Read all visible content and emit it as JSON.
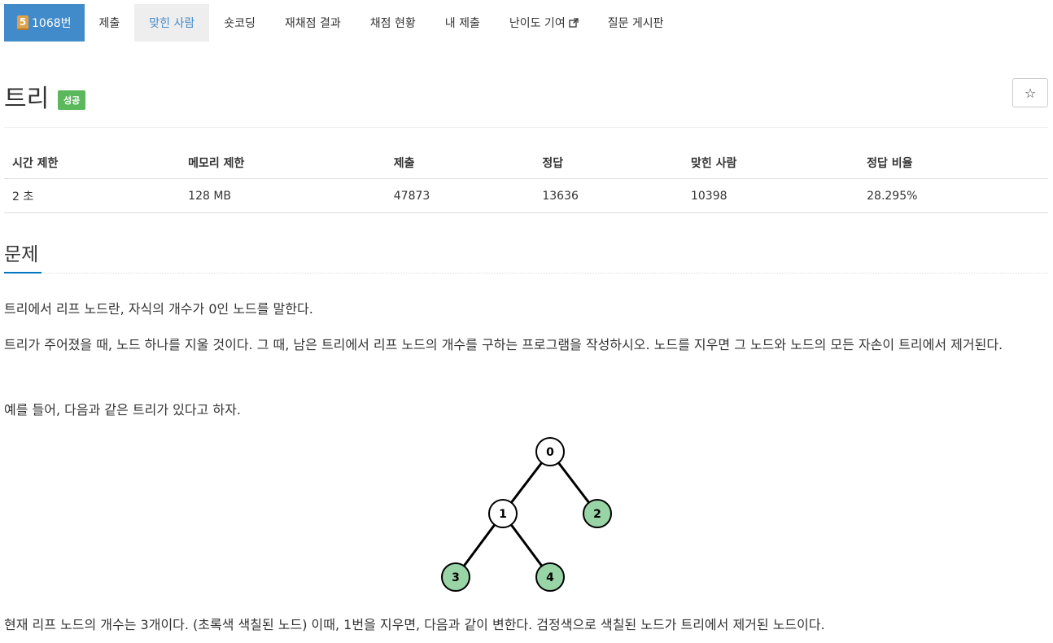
{
  "nav": {
    "problem_badge": "5",
    "problem_number": "1068번",
    "tabs": [
      "제출",
      "맞힌 사람",
      "숏코딩",
      "재채점 결과",
      "채점 현황",
      "내 제출",
      "난이도 기여",
      "질문 게시판"
    ]
  },
  "header": {
    "title": "트리",
    "status": "성공",
    "star": "☆"
  },
  "info_table": {
    "headers": [
      "시간 제한",
      "메모리 제한",
      "제출",
      "정답",
      "맞힌 사람",
      "정답 비율"
    ],
    "values": [
      "2 초",
      "128 MB",
      "47873",
      "13636",
      "10398",
      "28.295%"
    ]
  },
  "section": {
    "title": "문제",
    "paragraphs": [
      "트리에서 리프 노드란, 자식의 개수가 0인 노드를 말한다.",
      "트리가 주어졌을 때, 노드 하나를 지울 것이다. 그 때, 남은 트리에서 리프 노드의 개수를 구하는 프로그램을 작성하시오. 노드를 지우면 그 노드와 노드의 모든 자손이 트리에서 제거된다.",
      "예를 들어, 다음과 같은 트리가 있다고 하자.",
      "현재 리프 노드의 개수는 3개이다. (초록색 색칠된 노드) 이때, 1번을 지우면, 다음과 같이 변한다. 검정색으로 색칠된 노드가 트리에서 제거된 노드이다."
    ]
  },
  "tree_figure": {
    "nodes": [
      {
        "label": "0",
        "leaf": false
      },
      {
        "label": "1",
        "leaf": false
      },
      {
        "label": "2",
        "leaf": true
      },
      {
        "label": "3",
        "leaf": true
      },
      {
        "label": "4",
        "leaf": true
      }
    ],
    "edges": [
      [
        "0",
        "1"
      ],
      [
        "0",
        "2"
      ],
      [
        "1",
        "3"
      ],
      [
        "1",
        "4"
      ]
    ],
    "colors": {
      "leaf_fill": "#99d4a6",
      "node_fill": "#ffffff",
      "stroke": "#000000"
    }
  },
  "colors": {
    "primary": "#428bca",
    "success": "#5cb85c",
    "section_accent": "#0076c0"
  }
}
